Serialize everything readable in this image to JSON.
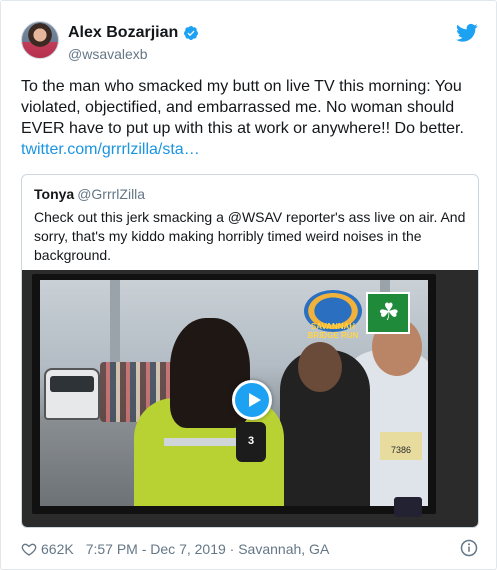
{
  "author": {
    "name": "Alex Bozarjian",
    "handle": "@wsavalexb",
    "verified": true
  },
  "tweet": {
    "text": "To the man who smacked my butt on live TV this morning: You violated, objectified, and embarrassed me. No woman should EVER have to put up with this at work or anywhere!! Do better.",
    "link": "twitter.com/grrrlzilla/sta…"
  },
  "quoted": {
    "name": "Tonya",
    "handle": "@GrrrlZilla",
    "text": "Check out this jerk smacking a @WSAV reporter's ass live on air. And sorry, that's my kiddo making horribly timed weird noises in the background.",
    "video": {
      "logo_text": "SAVANNAH BRIDGE RUN",
      "mic_flag": "3",
      "bib_number": "7386"
    }
  },
  "footer": {
    "likes": "662K",
    "timestamp": "7:57 PM - Dec 7, 2019 · Savannah, GA"
  },
  "colors": {
    "accent": "#1da1f2",
    "link": "#1b95e0",
    "muted": "#657786"
  },
  "icons": {
    "verified": "verified-badge-icon",
    "brand": "twitter-bird-icon",
    "like": "heart-icon",
    "info": "info-icon",
    "play": "play-icon"
  }
}
